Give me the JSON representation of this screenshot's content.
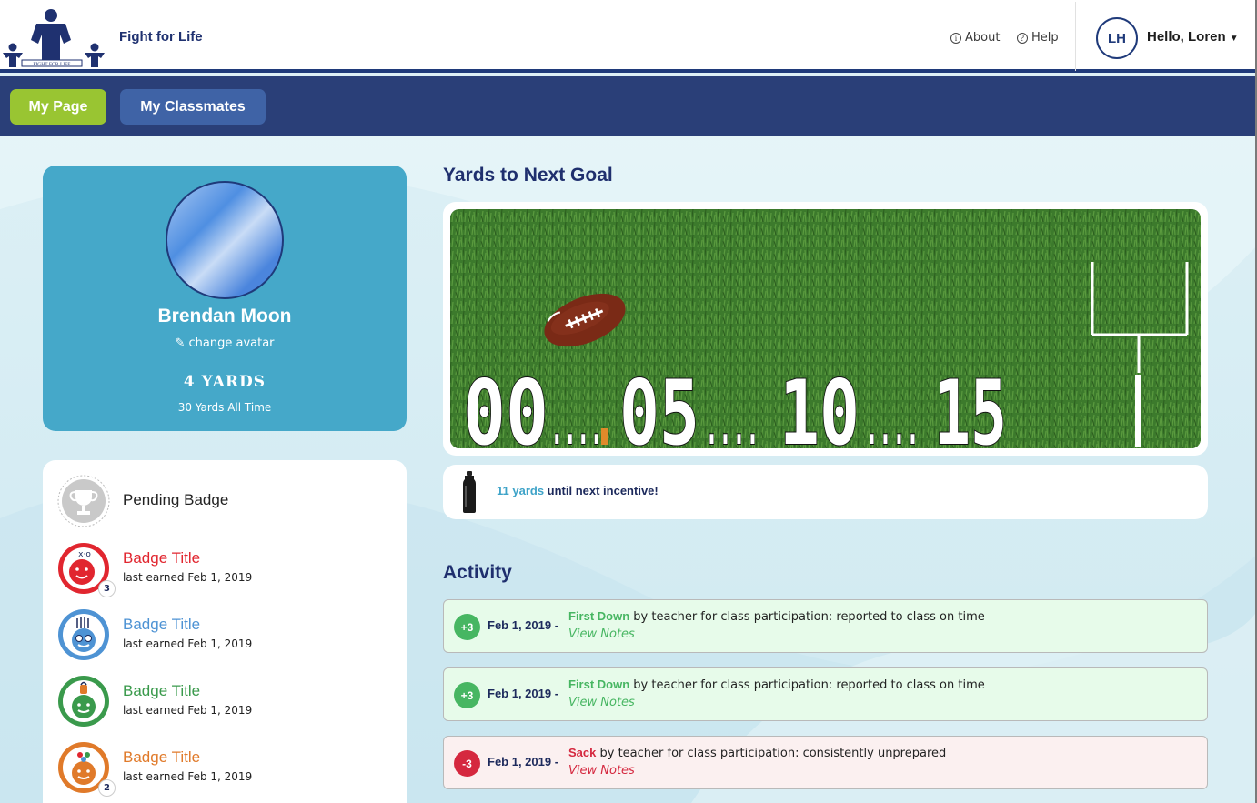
{
  "header": {
    "logo_text": "FIGHT FOR LIFE",
    "brand": "Fight for Life",
    "about": "About",
    "help": "Help",
    "user_initials": "LH",
    "greeting": "Hello, Loren",
    "info_glyph": "i",
    "help_glyph": "?"
  },
  "nav": {
    "my_page": "My Page",
    "my_classmates": "My Classmates",
    "active": "My Page"
  },
  "profile": {
    "name": "Brendan Moon",
    "change_avatar": "change avatar",
    "yards": "4 YARDS",
    "all_time": "30 Yards All Time"
  },
  "badges": {
    "pending": "Pending Badge",
    "items": [
      {
        "title": "Badge Title",
        "subtitle": "last earned Feb 1, 2019",
        "count": "3",
        "color": "#e1262f"
      },
      {
        "title": "Badge Title",
        "subtitle": "last earned Feb 1, 2019",
        "count": "",
        "color": "#4e93d4"
      },
      {
        "title": "Badge Title",
        "subtitle": "last earned Feb 1, 2019",
        "count": "",
        "color": "#3a9a4c"
      },
      {
        "title": "Badge Title",
        "subtitle": "last earned Feb 1, 2019",
        "count": "2",
        "color": "#e07a2a"
      }
    ]
  },
  "goal": {
    "heading": "Yards to Next Goal",
    "markers": [
      "00",
      "05",
      "10",
      "15"
    ],
    "dots": "....",
    "current_yards": 4,
    "incentive_yards": "11 yards",
    "incentive_text": " until next incentive!"
  },
  "activity": {
    "heading": "Activity",
    "items": [
      {
        "points": "+3",
        "date": "Feb 1, 2019 -",
        "kind": "First Down",
        "desc": " by teacher for class participation: reported to class on time",
        "notes": "View Notes",
        "tone": "pos"
      },
      {
        "points": "+3",
        "date": "Feb 1, 2019 -",
        "kind": "First Down",
        "desc": " by teacher for class participation: reported to class on time",
        "notes": "View Notes",
        "tone": "pos"
      },
      {
        "points": "-3",
        "date": "Feb 1, 2019 -",
        "kind": "Sack",
        "desc": " by teacher for class participation: consistently unprepared",
        "notes": "View Notes",
        "tone": "neg"
      }
    ]
  },
  "colors": {
    "navy": "#1f3a7a",
    "green_button": "#99c532",
    "blue_button": "#3f63a6",
    "profile_card": "#45a8c9",
    "positive": "#47b662",
    "negative": "#d5283f"
  }
}
